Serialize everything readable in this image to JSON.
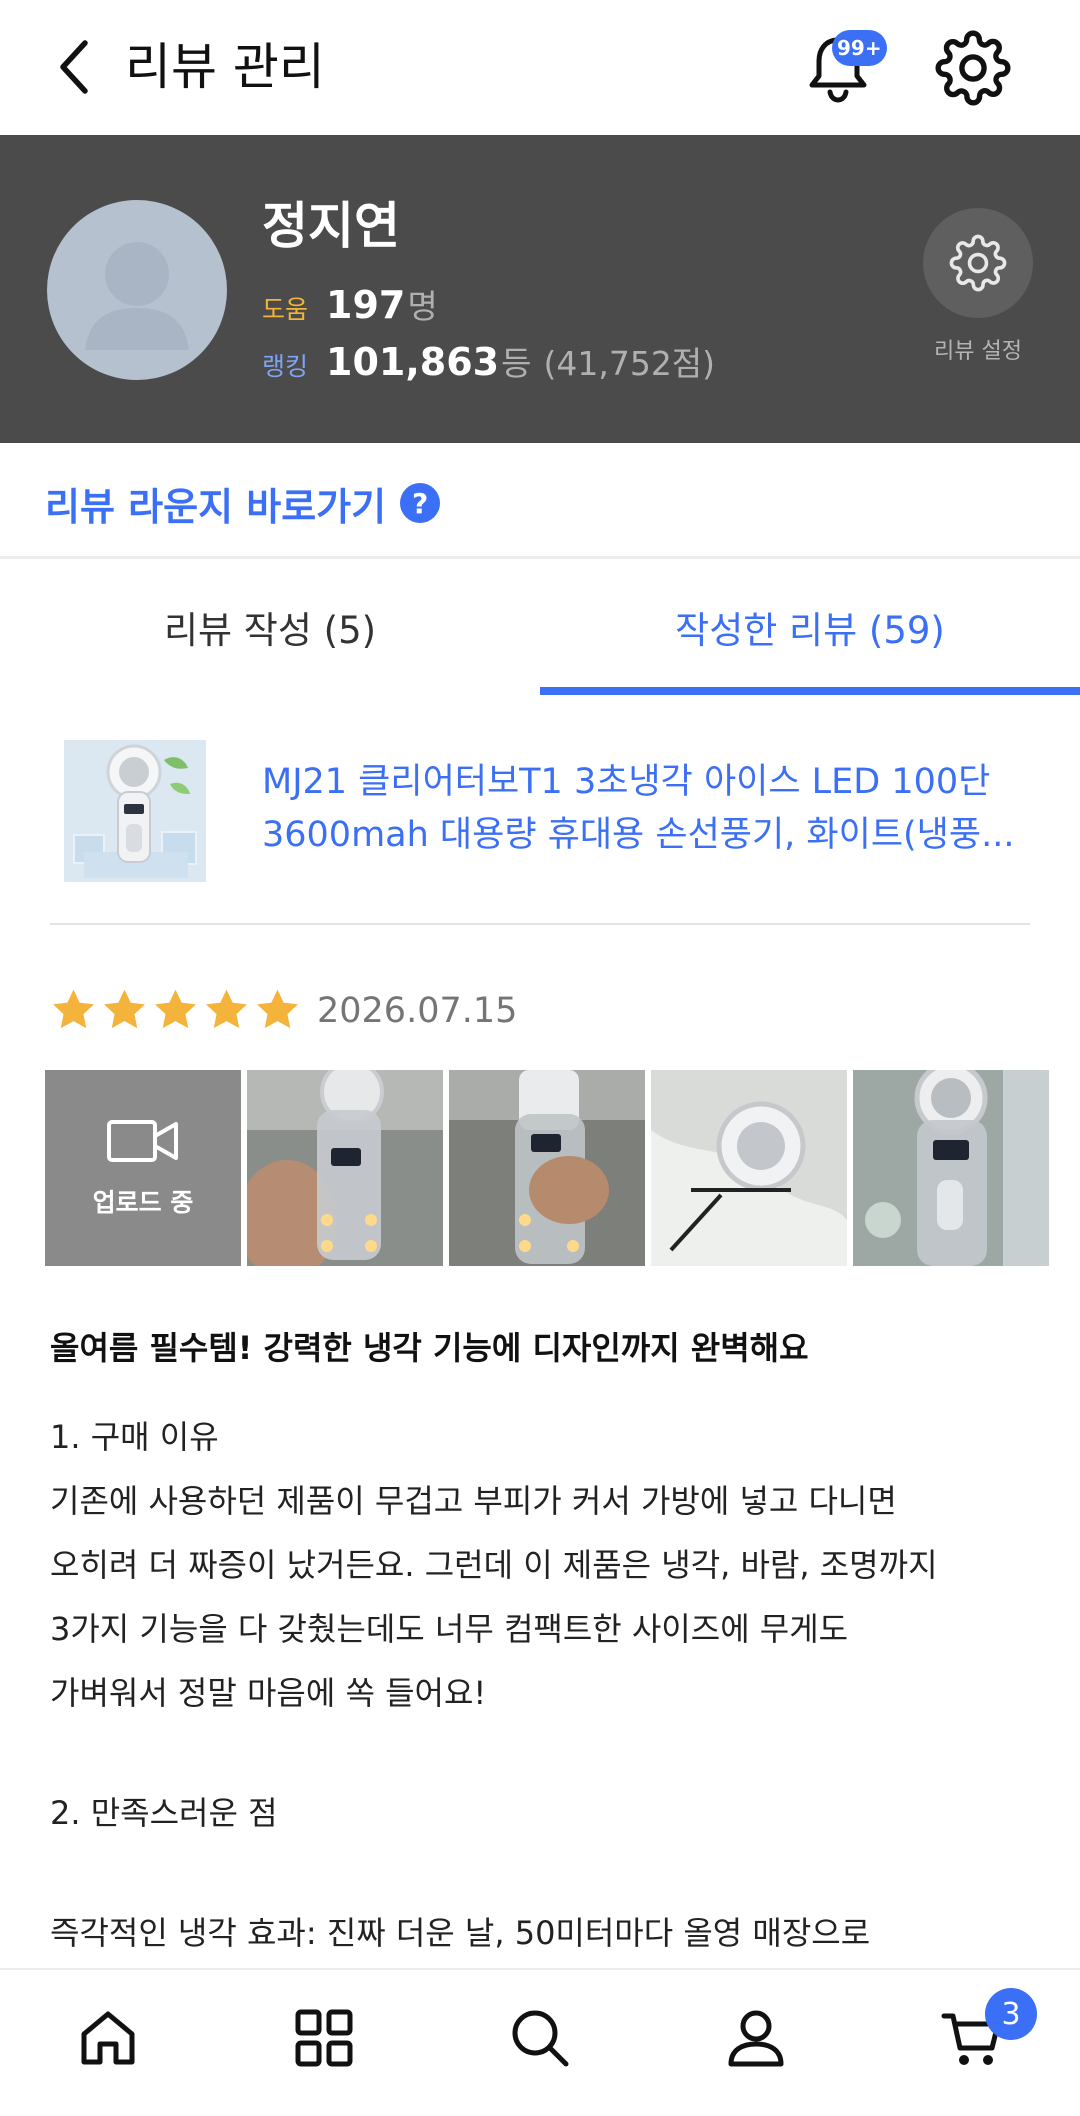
{
  "header": {
    "title": "리뷰 관리",
    "notification_badge": "99+"
  },
  "profile": {
    "name": "정지연",
    "help_label": "도움",
    "help_count": "197",
    "help_unit": "명",
    "rank_label": "랭킹",
    "rank_value": "101,863",
    "rank_unit": "등",
    "rank_extra": "(41,752점)",
    "settings_label": "리뷰 설정"
  },
  "lounge": {
    "link_text": "리뷰 라운지 바로가기",
    "help_mark": "?"
  },
  "tabs": [
    {
      "label": "리뷰 작성 (5)",
      "active": false
    },
    {
      "label": "작성한 리뷰 (59)",
      "active": true
    }
  ],
  "product": {
    "name_line1": "MJ21 클리어터보T1 3초냉각 아이스 LED 100단",
    "name_line2": "3600mah 대용량 휴대용 손선풍기, 화이트(냉풍..."
  },
  "review": {
    "rating": 5,
    "date": "2026.07.15",
    "upload_label": "업로드 중",
    "title": "올여름 필수템! 강력한 냉각 기능에 디자인까지 완벽해요",
    "body_lines": [
      "1. 구매 이유",
      "기존에 사용하던 제품이 무겁고 부피가 커서 가방에 넣고 다니면",
      "오히려 더 짜증이 났거든요.  그런데 이 제품은 냉각, 바람, 조명까지",
      "3가지 기능을 다 갖췄는데도 너무 컴팩트한 사이즈에 무게도",
      "가벼워서 정말 마음에 쏙 들어요!",
      "",
      "2. 만족스러운 점",
      "",
      "즉각적인 냉각 효과: 진짜 더운 날, 50미터마다 올영 매장으로"
    ]
  },
  "bottom_nav": {
    "cart_count": "3"
  },
  "colors": {
    "accent": "#3b6ff5",
    "profile_bg": "#4b4b4b",
    "star": "#f4b33a"
  }
}
